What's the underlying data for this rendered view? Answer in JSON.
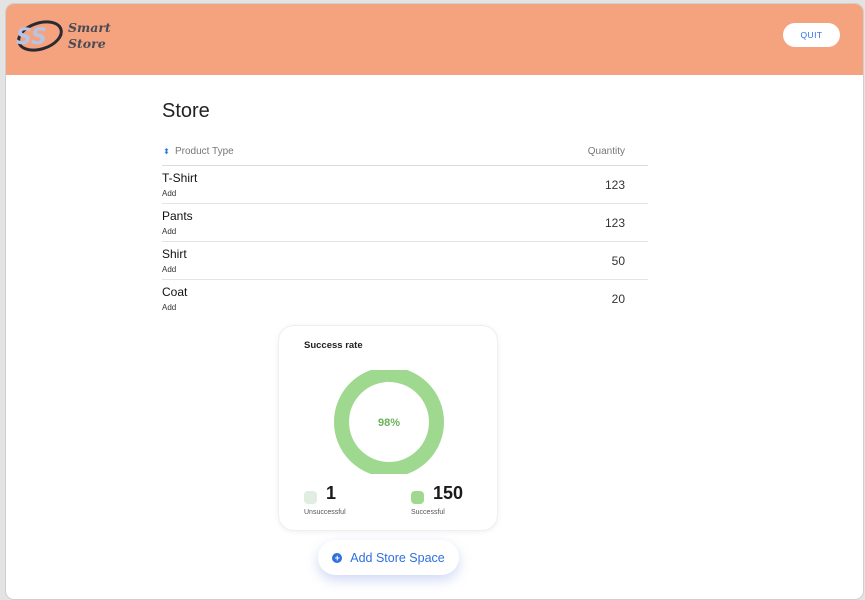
{
  "header": {
    "logo_line1": "Smart",
    "logo_line2": "Store",
    "quit_label": "QUIT",
    "background_color": "#f5a37f"
  },
  "main": {
    "title": "Store",
    "table": {
      "columns": [
        "Product Type",
        "Quantity"
      ],
      "sort_icon": "sort-icon",
      "rows": [
        {
          "name": "T-Shirt",
          "action": "Add",
          "quantity": "123"
        },
        {
          "name": "Pants",
          "action": "Add",
          "quantity": "123"
        },
        {
          "name": "Shirt",
          "action": "Add",
          "quantity": "50"
        },
        {
          "name": "Coat",
          "action": "Add",
          "quantity": "20"
        }
      ]
    },
    "success_card": {
      "title": "Success rate",
      "percent_label": "98%",
      "percent_value": 0.98,
      "unsuccessful": {
        "count": "1",
        "label": "Unsuccessful",
        "color": "#e0ede0"
      },
      "successful": {
        "count": "150",
        "label": "Successful",
        "color": "#9fd88f"
      },
      "track_color": "#e0ede0",
      "fill_color": "#9fd88f",
      "text_color": "#6cb25b"
    },
    "add_store_label": "Add Store Space",
    "add_icon": "plus-circle-icon"
  }
}
